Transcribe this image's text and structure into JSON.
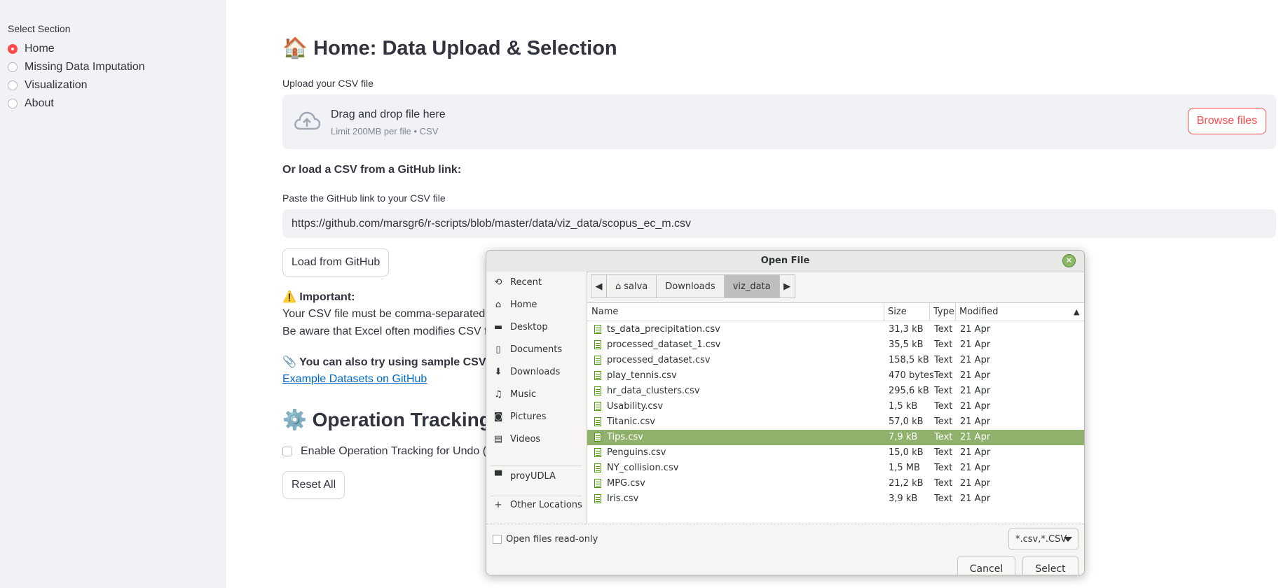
{
  "sidebar": {
    "title": "Select Section",
    "options": [
      {
        "label": "Home",
        "selected": true
      },
      {
        "label": "Missing Data Imputation",
        "selected": false
      },
      {
        "label": "Visualization",
        "selected": false
      },
      {
        "label": "About",
        "selected": false
      }
    ]
  },
  "main": {
    "title_icon": "🏠",
    "title": "Home: Data Upload & Selection",
    "upload_label": "Upload your CSV file",
    "dropzone": {
      "title": "Drag and drop file here",
      "subtitle": "Limit 200MB per file • CSV",
      "browse_label": "Browse files"
    },
    "github_heading": "Or load a CSV from a GitHub link:",
    "github_input_label": "Paste the GitHub link to your CSV file",
    "github_url": "https://github.com/marsgr6/r-scripts/blob/master/data/viz_data/scopus_ec_m.csv",
    "load_button": "Load from GitHub",
    "important_icon": "⚠️",
    "important_label": "Important:",
    "important_line1": "Your CSV file must be comma-separated, use",
    "important_line2": "Be aware that Excel often modifies CSV files",
    "sample_icon": "📎",
    "sample_label": "You can also try using sample CSV files:",
    "sample_link": "Example Datasets on GitHub",
    "tracking_icon": "⚙️",
    "tracking_title": "Operation Tracking Se",
    "tracking_checkbox": "Enable Operation Tracking for Undo (Ma",
    "reset_button": "Reset All"
  },
  "dialog": {
    "title": "Open File",
    "places": [
      {
        "label": "Recent",
        "icon": "recent-icon"
      },
      {
        "label": "Home",
        "icon": "home-icon"
      },
      {
        "label": "Desktop",
        "icon": "desktop-icon"
      },
      {
        "label": "Documents",
        "icon": "documents-icon"
      },
      {
        "label": "Downloads",
        "icon": "downloads-icon"
      },
      {
        "label": "Music",
        "icon": "music-icon"
      },
      {
        "label": "Pictures",
        "icon": "pictures-icon"
      },
      {
        "label": "Videos",
        "icon": "videos-icon"
      },
      {
        "label": "proyUDLA",
        "icon": "folder-icon"
      },
      {
        "label": "Other Locations",
        "icon": "plus-icon"
      }
    ],
    "path": [
      "salva",
      "Downloads",
      "viz_data"
    ],
    "columns": {
      "name": "Name",
      "size": "Size",
      "type": "Type",
      "modified": "Modified"
    },
    "files": [
      {
        "name": "ts_data_precipitation.csv",
        "size": "31,3 kB",
        "type": "Text",
        "modified": "21 Apr",
        "selected": false
      },
      {
        "name": "processed_dataset_1.csv",
        "size": "35,5 kB",
        "type": "Text",
        "modified": "21 Apr",
        "selected": false
      },
      {
        "name": "processed_dataset.csv",
        "size": "158,5 kB",
        "type": "Text",
        "modified": "21 Apr",
        "selected": false
      },
      {
        "name": "play_tennis.csv",
        "size": "470 bytes",
        "type": "Text",
        "modified": "21 Apr",
        "selected": false
      },
      {
        "name": "hr_data_clusters.csv",
        "size": "295,6 kB",
        "type": "Text",
        "modified": "21 Apr",
        "selected": false
      },
      {
        "name": "Usability.csv",
        "size": "1,5 kB",
        "type": "Text",
        "modified": "21 Apr",
        "selected": false
      },
      {
        "name": "Titanic.csv",
        "size": "57,0 kB",
        "type": "Text",
        "modified": "21 Apr",
        "selected": false
      },
      {
        "name": "Tips.csv",
        "size": "7,9 kB",
        "type": "Text",
        "modified": "21 Apr",
        "selected": true
      },
      {
        "name": "Penguins.csv",
        "size": "15,0 kB",
        "type": "Text",
        "modified": "21 Apr",
        "selected": false
      },
      {
        "name": "NY_collision.csv",
        "size": "1,5 MB",
        "type": "Text",
        "modified": "21 Apr",
        "selected": false
      },
      {
        "name": "MPG.csv",
        "size": "21,2 kB",
        "type": "Text",
        "modified": "21 Apr",
        "selected": false
      },
      {
        "name": "Iris.csv",
        "size": "3,9 kB",
        "type": "Text",
        "modified": "21 Apr",
        "selected": false
      }
    ],
    "read_only_label": "Open files read-only",
    "filter": "*.csv,*.CSV",
    "cancel": "Cancel",
    "select": "Select"
  },
  "colors": {
    "accent": "#FF4B4B",
    "sidebar_bg": "#F0F2F6",
    "selection": "#8FB16C",
    "link": "#0068C9"
  }
}
